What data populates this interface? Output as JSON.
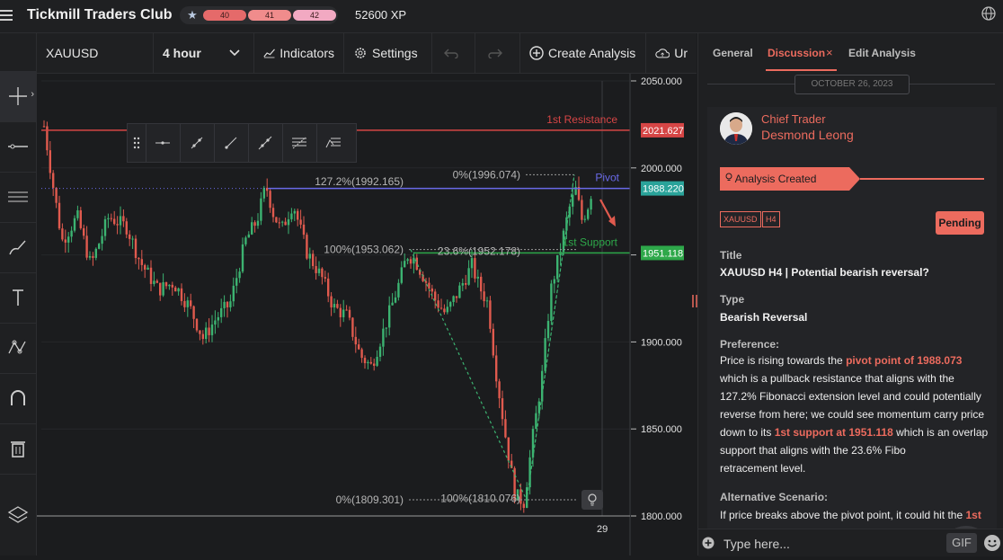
{
  "topbar": {
    "title": "Tickmill Traders Club",
    "xp_levels": [
      "40",
      "41",
      "42"
    ],
    "xp": "52600 XP",
    "menu_icon": "hamburger-icon",
    "globe_icon": "globe-icon"
  },
  "toolbar": {
    "symbol": "XAUUSD",
    "interval": "4 hour",
    "indicators": "Indicators",
    "settings": "Settings",
    "create": "Create Analysis",
    "upload": "Ur"
  },
  "chart_data": {
    "type": "candlestick",
    "ylim": [
      1800,
      2050
    ],
    "yticks": [
      "2050.000",
      "2000.000",
      "1950.000",
      "1900.000",
      "1850.000",
      "1800.000"
    ],
    "xtick": "29",
    "price_labels": [
      {
        "text": "2021.627",
        "value": 2021.627,
        "color": "#d64545"
      },
      {
        "text": "1988.220",
        "value": 1988.22,
        "color": "#2aa39a"
      },
      {
        "text": "1951.118",
        "value": 1951.118,
        "color": "#2ea84a"
      }
    ],
    "level_lines": [
      {
        "name": "1st Resistance",
        "value": 2021.627,
        "color": "#d64545"
      },
      {
        "name": "Pivot",
        "value": 1988.22,
        "color": "#6a6ae8"
      },
      {
        "name": "1st Support",
        "value": 1951.118,
        "color": "#2ea84a"
      }
    ],
    "fib_labels": [
      "127.2%(1992.165)",
      "0%(1996.074)",
      "100%(1953.062)",
      "23.6%(1952.178)",
      "0%(1809.301)",
      "100%(1810.076)"
    ],
    "bull_color": "#3cb371",
    "bear_color": "#e05a4e"
  },
  "panel": {
    "tabs": [
      "General",
      "Discussion",
      "Edit Analysis"
    ],
    "date": "OCTOBER 26, 2023",
    "role": "Chief Trader",
    "trader": "Desmond Leong",
    "banner": "Analysis Created",
    "tags": [
      "XAUUSD",
      "H4"
    ],
    "status": "Pending",
    "title_label": "Title",
    "title_value": "XAUUSD H4 | Potential bearish reversal?",
    "type_label": "Type",
    "type_value": "Bearish Reversal",
    "pref_label": "Preference:",
    "pref_1": "Price is rising towards the ",
    "pref_hl1": "pivot point of 1988.073",
    "pref_2": " which is a pullback resistance that aligns with the 127.2% Fibonacci extension level and could potentially reverse from here; we could see momentum carry price down to its ",
    "pref_hl2": "1st support at 1951.118",
    "pref_3": " which is an overlap support that aligns with the 23.6% Fibo",
    "pref_4": " retracement level.",
    "alt_label": "Alternative Scenario:",
    "alt_1": "If price breaks above the pivot point, it could hit the ",
    "alt_hl": "1st",
    "input_placeholder": "Type here...",
    "gif": "GIF",
    "accent": "#ec6b5e"
  }
}
